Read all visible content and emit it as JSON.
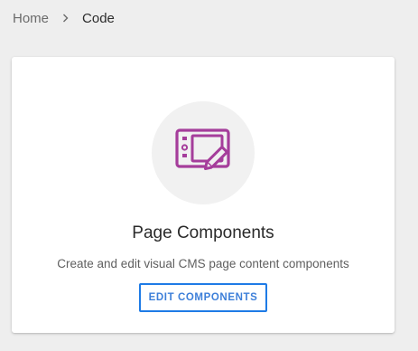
{
  "breadcrumb": {
    "home": "Home",
    "current": "Code"
  },
  "card": {
    "icon": "tablet-pen-icon",
    "title": "Page Components",
    "description": "Create and edit visual CMS page content components",
    "button_label": "EDIT COMPONENTS"
  },
  "colors": {
    "icon_accent": "#a53d9b",
    "button_border": "#1e7be6",
    "button_text": "#3d7fd9",
    "page_background": "#eeeeee",
    "icon_circle": "#f1f1f1"
  }
}
